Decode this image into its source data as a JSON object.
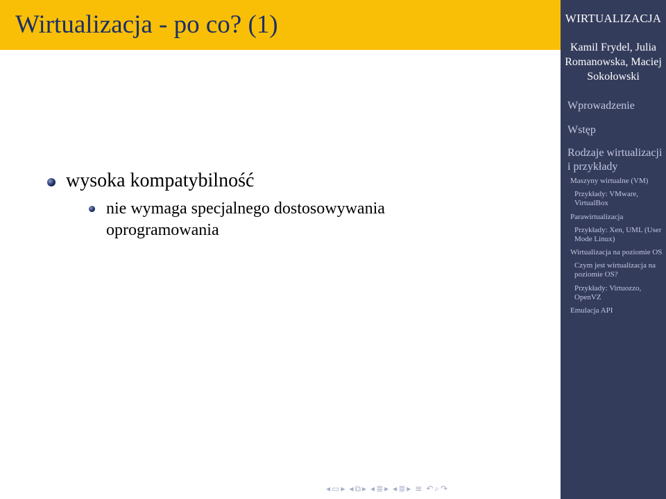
{
  "frame": {
    "title": "Wirtualizacja - po co? (1)",
    "bullets": [
      {
        "text": "wysoka kompatybilność",
        "children": [
          {
            "text": "nie wymaga specjalnego dostosowywania oprogramowania"
          }
        ]
      }
    ]
  },
  "sidebar": {
    "title": "WIRTUALIZACJA",
    "authors": "Kamil Frydel, Julia Romanowska, Maciej Sokołowski",
    "sections": [
      {
        "label": "Wprowadzenie"
      },
      {
        "label": "Wstęp"
      },
      {
        "label": "Rodzaje wirtualizacji i przykłady",
        "subsections": [
          {
            "label": "Maszyny wirtualne (VM)",
            "items": [
              "Przykłady: VMware, VirtualBox"
            ]
          },
          {
            "label": "Parawirtualizacja",
            "items": [
              "Przykłady: Xen, UML (User Mode Linux)"
            ]
          },
          {
            "label": "Wirtualizacja na poziomie OS",
            "items": [
              "Czym jest wirtualizacja na poziomie OS?",
              "Przykłady: Virtuozzo, OpenVZ"
            ]
          },
          {
            "label": "Emulacja API",
            "items": []
          }
        ]
      }
    ]
  },
  "colors": {
    "title_bar": "#f9bf07",
    "title_text": "#1c2f66",
    "sidebar_bg": "#343c5c",
    "sidebar_text": "#c3c8e0"
  },
  "navigation": {
    "icons": [
      "frame-prev-icon",
      "frame-icon",
      "frame-next-icon",
      "subsection-prev-icon",
      "subsection-icon",
      "subsection-next-icon",
      "section-prev-icon",
      "section-icon",
      "section-next-icon",
      "subsub-prev-icon",
      "subsub-icon",
      "subsub-next-icon",
      "align-icon",
      "search-back-icon",
      "search-icon",
      "search-forward-icon"
    ]
  }
}
